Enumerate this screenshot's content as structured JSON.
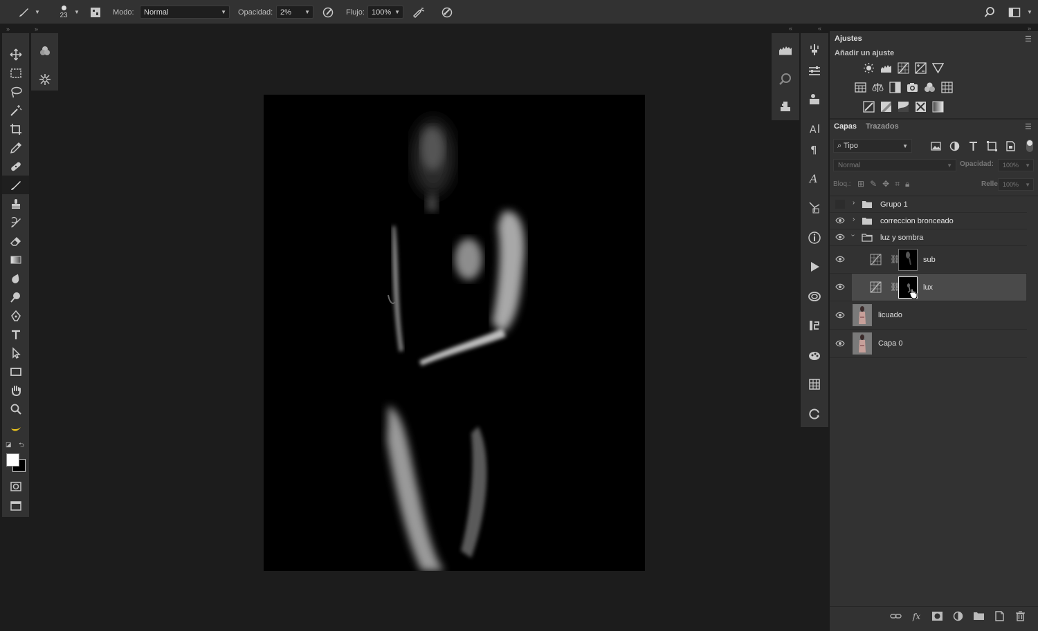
{
  "options_bar": {
    "brush_size": "23",
    "mode_label": "Modo:",
    "mode_value": "Normal",
    "opacity_label": "Opacidad:",
    "opacity_value": "2%",
    "flow_label": "Flujo:",
    "flow_value": "100%"
  },
  "adjustments": {
    "title": "Ajustes",
    "subtitle": "Añadir un ajuste"
  },
  "layers_panel": {
    "tab_layers": "Capas",
    "tab_paths": "Trazados",
    "filter_kind": "Tipo",
    "blend_mode": "Normal",
    "opacity_label": "Opacidad:",
    "opacity_value": "100%",
    "lock_label": "Bloq.:",
    "fill_label": "Relleno:",
    "fill_value": "100%",
    "layers": [
      {
        "name": "Grupo 1",
        "type": "group",
        "visible": false
      },
      {
        "name": "correccion bronceado",
        "type": "group",
        "visible": true
      },
      {
        "name": "luz y sombra",
        "type": "group-open",
        "visible": true
      },
      {
        "name": "sub",
        "type": "adjustment",
        "visible": true
      },
      {
        "name": "lux",
        "type": "adjustment",
        "visible": true,
        "selected": true
      },
      {
        "name": "licuado",
        "type": "pixel",
        "visible": true
      },
      {
        "name": "Capa 0",
        "type": "pixel",
        "visible": true
      }
    ]
  },
  "colors": {
    "panel_bg": "#323232",
    "app_bg": "#1c1c1c",
    "selected_row": "#4a4a4a",
    "highlight_tool": "#e8c21e"
  }
}
